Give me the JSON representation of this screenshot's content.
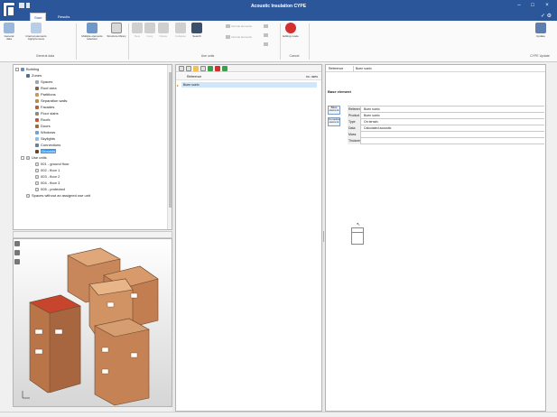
{
  "window": {
    "title": "Acoustic Insulation CYPE"
  },
  "tabs": {
    "items": [
      "Start",
      "Results"
    ]
  },
  "ribbon": {
    "buttons": [
      {
        "label": "General data"
      },
      {
        "label": "Internal elements Apply/remove"
      },
      {
        "label": "Multiple elements selection"
      },
      {
        "label": "Structure library"
      },
      {
        "label": "New"
      },
      {
        "label": "Copy"
      },
      {
        "label": "Delete"
      },
      {
        "label": "Collapse"
      },
      {
        "label": "Search"
      },
      {
        "label": "Editing mode"
      },
      {
        "label": "Update"
      }
    ],
    "small_buttons": [
      "Internal elements",
      "Internal elements"
    ],
    "groups": [
      "General data",
      "Use units",
      "Cancel",
      "CYPE Update"
    ]
  },
  "tree": {
    "root": "Building",
    "items": [
      {
        "label": "Zones",
        "level": 1,
        "icon": "folder-icon"
      },
      {
        "label": "Spaces",
        "level": 2,
        "icon": "box-icon"
      },
      {
        "label": "Roof area",
        "level": 2,
        "icon": "roof-icon"
      },
      {
        "label": "Partitions",
        "level": 2,
        "icon": "wall-icon"
      },
      {
        "label": "Separation walls",
        "level": 2,
        "icon": "wall-icon"
      },
      {
        "label": "Facades",
        "level": 2,
        "icon": "facade-icon"
      },
      {
        "label": "Floor slabs",
        "level": 2,
        "icon": "slab-icon"
      },
      {
        "label": "Roofs",
        "level": 2,
        "icon": "roof-icon"
      },
      {
        "label": "Doors",
        "level": 2,
        "icon": "door-icon"
      },
      {
        "label": "Windows",
        "level": 2,
        "icon": "window-icon"
      },
      {
        "label": "Skylights",
        "level": 2,
        "icon": "skylight-icon"
      },
      {
        "label": "Connections",
        "level": 2,
        "icon": "connection-icon"
      },
      {
        "label": "Grounds",
        "level": 2,
        "icon": "ground-icon",
        "selected": true
      },
      {
        "label": "Use units",
        "level": 1,
        "icon": "folder-icon"
      },
      {
        "label": "001 - ground floor",
        "level": 2,
        "icon": "doc-icon"
      },
      {
        "label": "002 - floor 1",
        "level": 2,
        "icon": "doc-icon"
      },
      {
        "label": "003 - floor 2",
        "level": 2,
        "icon": "doc-icon"
      },
      {
        "label": "004 - floor 3",
        "level": 2,
        "icon": "doc-icon"
      },
      {
        "label": "005 - protected",
        "level": 2,
        "icon": "doc-icon"
      },
      {
        "label": "Spaces without an assigned use unit",
        "level": 1,
        "icon": "doc-icon"
      }
    ]
  },
  "list": {
    "header_name": "Reference",
    "header_count": "no. uses",
    "rows": [
      {
        "name": "Buen suelo",
        "count": ""
      }
    ]
  },
  "properties": {
    "reference_label": "Reference",
    "reference_value": "Buen suelo",
    "section_title": "Base element",
    "side_buttons": [
      "Base element",
      "Complete element"
    ],
    "rows": [
      {
        "key": "Reference",
        "value": "Buen suelo"
      },
      {
        "key": "Product",
        "value": "Buen suelo"
      },
      {
        "key": "Type",
        "value": "On terrain"
      },
      {
        "key": "Data",
        "value": "Calculated acoustic"
      },
      {
        "key": "Mass",
        "value": ""
      },
      {
        "key": "Thickness",
        "value": ""
      }
    ]
  },
  "colors": {
    "titlebar": "#2b579a",
    "selection": "#3399ff",
    "row_highlight": "#cfe6fb",
    "delete_red": "#d32f2f",
    "building_brown": "#c8875a",
    "roof_red": "#c7442d"
  }
}
